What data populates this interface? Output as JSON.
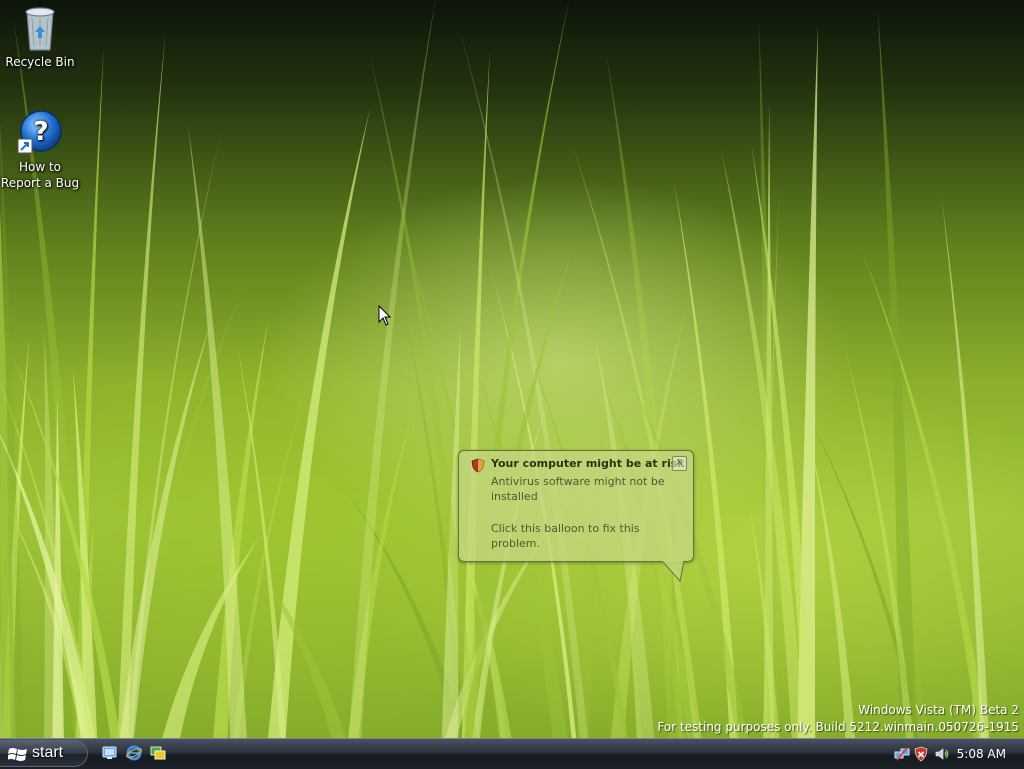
{
  "desktop": {
    "icons": [
      {
        "label": "Recycle Bin"
      },
      {
        "label_line1": "How to",
        "label_line2": "Report a Bug"
      }
    ]
  },
  "balloon": {
    "title": "Your computer might be at risk",
    "message": "Antivirus software might not be installed",
    "action": "Click this balloon to fix this problem.",
    "close_symbol": "×"
  },
  "watermark": {
    "line1": "Windows Vista (TM) Beta 2",
    "line2": "For testing purposes only. Build 5212.winmain.050726-1915"
  },
  "taskbar": {
    "start_label": "start",
    "quick_launch": [
      "show-desktop-icon",
      "internet-explorer-icon",
      "switch-windows-icon"
    ],
    "tray_icons": [
      "network-icon",
      "security-shield-icon",
      "volume-icon"
    ],
    "clock": "5:08 AM"
  },
  "colors": {
    "balloon_bg": "#c4d680",
    "taskbar": "#1c2028"
  }
}
